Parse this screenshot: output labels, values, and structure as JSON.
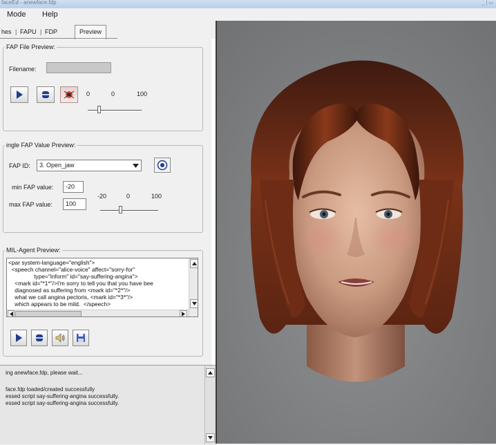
{
  "window": {
    "title": "faceEd - anewface.fdp",
    "controls": "_ | ▭"
  },
  "menu": {
    "items": [
      "Mode",
      "Help"
    ]
  },
  "tabs": [
    {
      "label": "hes",
      "active": false
    },
    {
      "label": "FAPU",
      "active": false
    },
    {
      "label": "FDP",
      "active": false
    },
    {
      "label": "Preview",
      "active": true
    }
  ],
  "fap_file_preview": {
    "title": "FAP File Preview:",
    "filename_label": "Filename:",
    "filename_value": "",
    "scale": {
      "min": "0",
      "mid": "0",
      "max": "100"
    },
    "slider_value_fraction": 0.2
  },
  "single_fap": {
    "title": "ingle FAP Value Preview:",
    "fap_id_label": "FAP ID:",
    "fap_id_value": "3. Open_jaw",
    "min_label": "min FAP value:",
    "min_value": "-20",
    "max_label": "max FAP value:",
    "max_value": "100",
    "scale": {
      "min": "-20",
      "mid": "0",
      "max": "100"
    },
    "slider_value_fraction": 0.35
  },
  "apml_preview": {
    "title": "MIL-Agent Preview:",
    "lines": [
      "<par system-language=\"english\">",
      "  <speech channel=\"alice-voice\" affect=\"sorry-for\"",
      "                type=\"inform\" id=\"say-suffering-angina\">",
      "    <mark id=\"*1*\"/>I'm sorry to tell you that you have bee",
      "    diagnosed as suffering from <mark id=\"*2*\"/>",
      "    what we call angina pectoris, <mark id=\"*3*\"/>",
      "    which appears to be mild.  </speech>"
    ]
  },
  "log": {
    "lines": [
      "ing anewface.fdp, please wait...",
      "",
      "face.fdp loaded/created successfully",
      "essed script say-suffering-angina successfully.",
      "essed script say-suffering-angina successfully."
    ]
  },
  "colors": {
    "viewport_bg": "#7c7e80",
    "hair": "#6a2a16",
    "skin": "#c99a80"
  }
}
